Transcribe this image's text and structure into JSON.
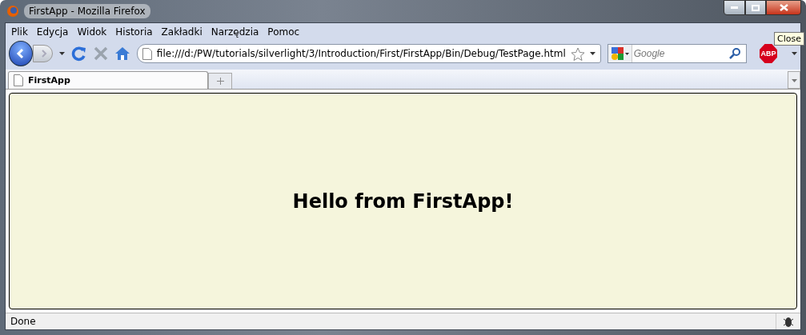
{
  "window": {
    "title": "FirstApp - Mozilla Firefox"
  },
  "menu": [
    "Plik",
    "Edycja",
    "Widok",
    "Historia",
    "Zakładki",
    "Narzędzia",
    "Pomoc"
  ],
  "address": {
    "value": "file:///d:/PW/tutorials/silverlight/3/Introduction/First/FirstApp/Bin/Debug/TestPage.html"
  },
  "search": {
    "placeholder": "Google"
  },
  "adblock": {
    "label": "ABP"
  },
  "tooltip": "Close",
  "tabs": [
    {
      "label": "FirstApp",
      "selected": true
    }
  ],
  "page": {
    "heading": "Hello from FirstApp!"
  },
  "status_bar": {
    "text": "Done"
  }
}
